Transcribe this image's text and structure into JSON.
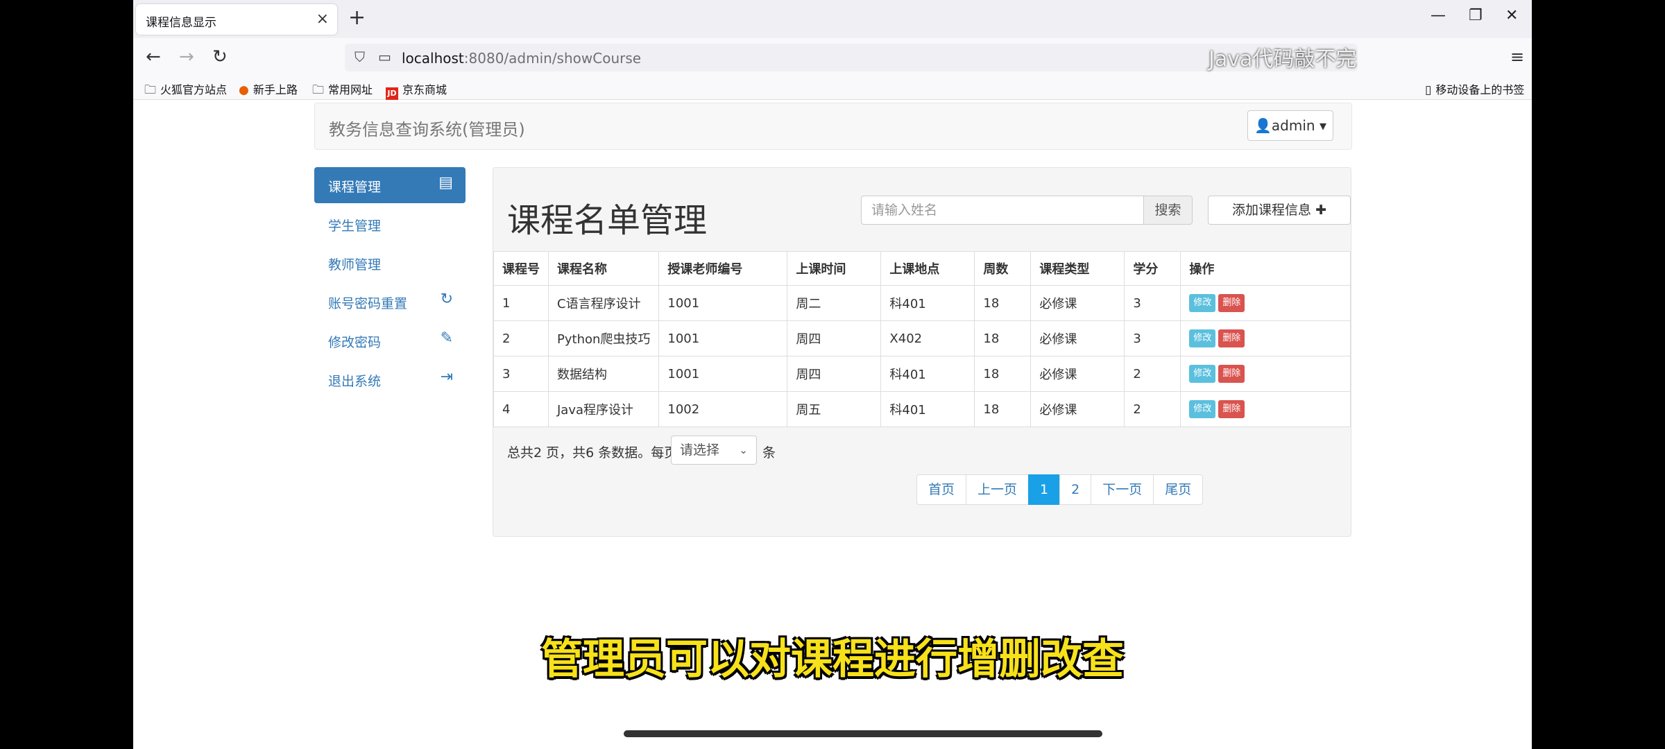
{
  "browser": {
    "tab_title": "课程信息显示",
    "url_host": "localhost",
    "url_rest": ":8080/admin/showCourse",
    "watermark": "Java代码敲不完",
    "bookmarks": [
      "火狐官方站点",
      "新手上路",
      "常用网址",
      "京东商城"
    ],
    "mobile_bookmarks": "移动设备上的书签"
  },
  "header": {
    "brand": "教务信息查询系统(管理员)",
    "user": "admin"
  },
  "sidebar": {
    "items": [
      {
        "label": "课程管理",
        "icon": "book-icon"
      },
      {
        "label": "学生管理"
      },
      {
        "label": "教师管理"
      },
      {
        "label": "账号密码重置",
        "icon": "refresh-icon"
      },
      {
        "label": "修改密码",
        "icon": "pencil-icon"
      },
      {
        "label": "退出系统",
        "icon": "logout-icon"
      }
    ]
  },
  "main": {
    "title": "课程名单管理",
    "search_placeholder": "请输入姓名",
    "search_label": "搜索",
    "add_label": "添加课程信息"
  },
  "table": {
    "headers": [
      "课程号",
      "课程名称",
      "授课老师编号",
      "上课时间",
      "上课地点",
      "周数",
      "课程类型",
      "学分",
      "操作"
    ],
    "rows": [
      [
        "1",
        "C语言程序设计",
        "1001",
        "周二",
        "科401",
        "18",
        "必修课",
        "3"
      ],
      [
        "2",
        "Python爬虫技巧",
        "1001",
        "周四",
        "X402",
        "18",
        "必修课",
        "3"
      ],
      [
        "3",
        "数据结构",
        "1001",
        "周四",
        "科401",
        "18",
        "必修课",
        "2"
      ],
      [
        "4",
        "Java程序设计",
        "1002",
        "周五",
        "科401",
        "18",
        "必修课",
        "2"
      ]
    ],
    "edit_label": "修改",
    "delete_label": "删除"
  },
  "pagination": {
    "info": "总共2 页，共6 条数据。每页",
    "select_value": "请选择",
    "unit": "条",
    "first": "首页",
    "prev": "上一页",
    "pages": [
      "1",
      "2"
    ],
    "current": "1",
    "next": "下一页",
    "last": "尾页"
  },
  "caption": "管理员可以对课程进行增删改查",
  "colors": {
    "primary": "#337ab7",
    "info": "#5bc0de",
    "danger": "#d9534f",
    "caption": "#f7e11a"
  }
}
